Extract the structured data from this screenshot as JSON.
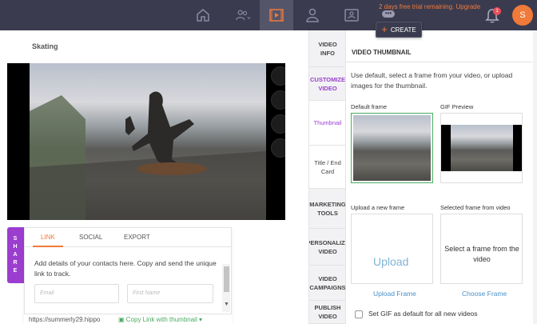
{
  "topbar": {
    "trial_text": "2 days free trial remaining. Upgrade",
    "trial_dots": "•••",
    "create_label": "CREATE",
    "create_icon": "+",
    "notification_count": "1",
    "avatar_initial": "S",
    "accent": "#f07a3a"
  },
  "video": {
    "title": "Skating"
  },
  "share": {
    "tab_letters": [
      "S",
      "H",
      "A",
      "R",
      "E"
    ],
    "tabs": [
      "LINK",
      "SOCIAL",
      "EXPORT"
    ],
    "description": "Add details of your contacts here. Copy and send the unique link to track.",
    "email_placeholder": "Email",
    "first_name_placeholder": "First Name",
    "link_url": "https://summerly29.hippo",
    "copy_label": "Copy Link with thumbnail"
  },
  "vnav": {
    "items": [
      "VIDEO INFO",
      "CUSTOMIZE VIDEO",
      "Thumbnail",
      "Title / End Card",
      "MARKETING TOOLS",
      "PERSONALIZE VIDEO",
      "VIDEO CAMPAIGNS",
      "PUBLISH VIDEO"
    ]
  },
  "thumbnail": {
    "heading": "VIDEO THUMBNAIL",
    "description": "Use default, select a frame from your video, or upload images for the thumbnail.",
    "default_frame_label": "Default frame",
    "gif_preview_label": "GIF Preview",
    "upload_new_label": "Upload a new frame",
    "selected_frame_label": "Selected frame from video",
    "upload_text": "Upload",
    "select_frame_text": "Select a frame from the video",
    "upload_frame_link": "Upload Frame",
    "choose_frame_link": "Choose Frame",
    "gif_default_label": "Set GIF as default for all new videos"
  }
}
